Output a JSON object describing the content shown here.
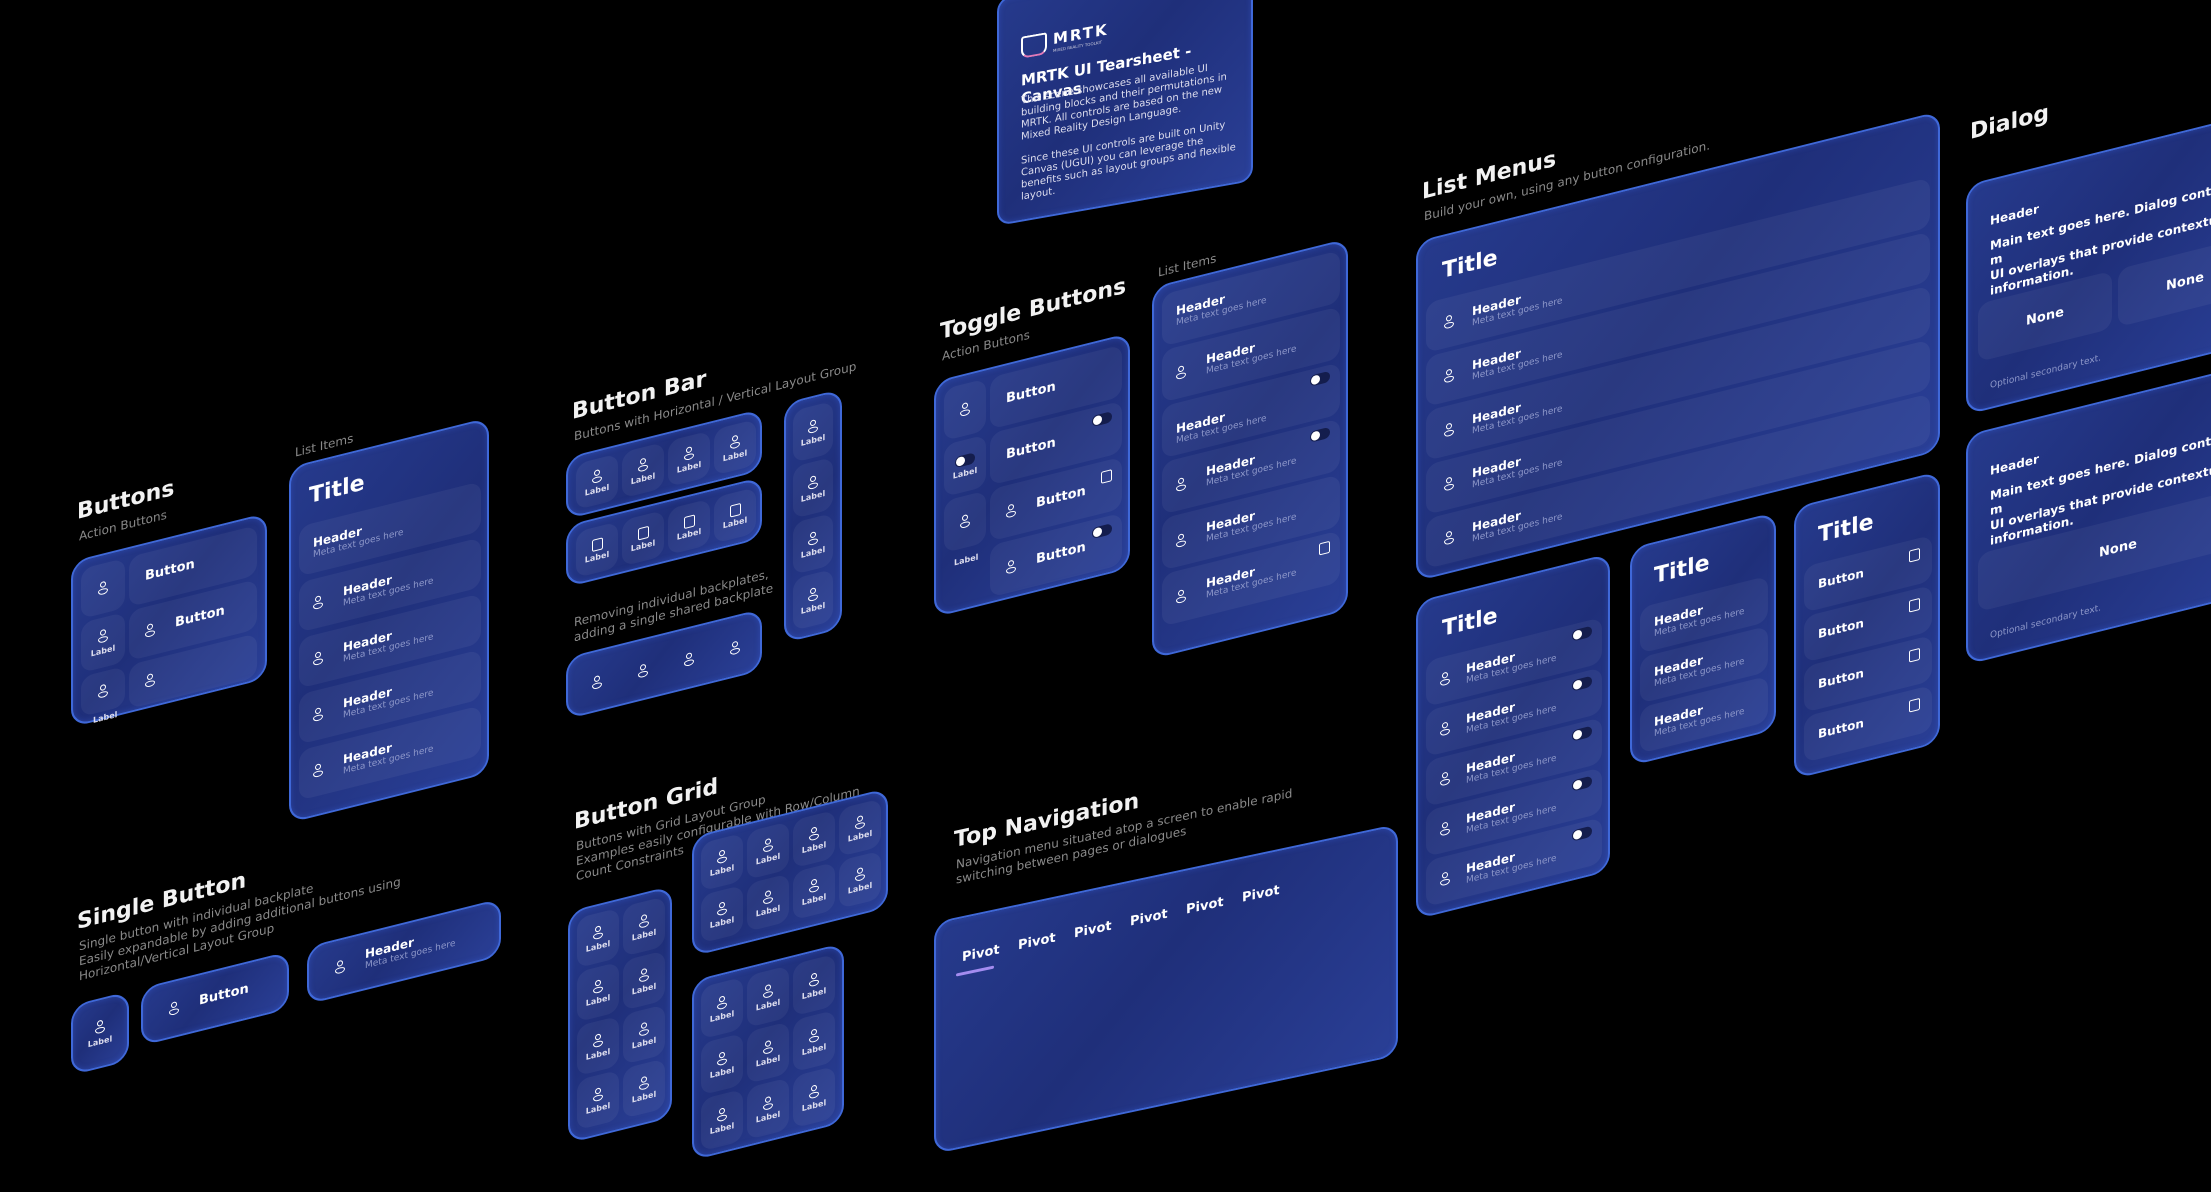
{
  "intro": {
    "logo_text": "MRTK",
    "logo_subtext": "MIXED REALITY TOOLKIT",
    "title": "MRTK UI Tearsheet - Canvas",
    "para1": "This scene showcases all available UI building blocks and their permutations in MRTK. All controls are based on the new Mixed Reality Design Language.",
    "para2": "Since these UI controls are built on Unity Canvas (UGUI) you can leverage the benefits such as layout groups and flexible layout."
  },
  "buttons": {
    "title": "Buttons",
    "subtitle": "Action Buttons",
    "button_label": "Button",
    "icon_label": "Label",
    "list_caption": "List Items",
    "list_title": "Title",
    "header": "Header",
    "meta": "Meta text goes here"
  },
  "single_button": {
    "title": "Single Button",
    "desc1": "Single button with individual backplate",
    "desc2": "Easily expandable by adding additional buttons using",
    "desc3": "Horizontal/Vertical Layout Group",
    "icon_label": "Label",
    "button_label": "Button",
    "header": "Header",
    "meta": "Meta text goes here"
  },
  "button_bar": {
    "title": "Button Bar",
    "subtitle": "Buttons with Horizontal / Vertical Layout Group",
    "shared_desc1": "Removing individual backplates,",
    "shared_desc2": "adding a single shared backplate",
    "icon_label": "Label"
  },
  "button_grid": {
    "title": "Button Grid",
    "desc1": "Buttons with Grid Layout Group",
    "desc2": "Examples easily configurable with Row/Column",
    "desc3": "Count Constraints",
    "icon_label": "Label"
  },
  "toggle_buttons": {
    "title": "Toggle Buttons",
    "subtitle": "Action Buttons",
    "button_label": "Button",
    "icon_label": "Label",
    "list_caption": "List Items",
    "header": "Header",
    "meta": "Meta text goes here"
  },
  "top_navigation": {
    "title": "Top Navigation",
    "desc1": "Navigation menu situated atop a screen to enable rapid",
    "desc2": "switching between pages or dialogues",
    "pivots": [
      "Pivot",
      "Pivot",
      "Pivot",
      "Pivot",
      "Pivot",
      "Pivot"
    ],
    "active_index": 0
  },
  "list_menus": {
    "title": "List Menus",
    "subtitle": "Build your own, using any button configuration.",
    "panel_title": "Title",
    "header": "Header",
    "meta": "Meta text goes here",
    "button_label": "Button"
  },
  "dialog": {
    "title": "Dialog",
    "header": "Header",
    "main_text": "Main text goes here. Dialog controls are modal UI overlays that provide contextual app information.",
    "main_line1": "Main text goes here. Dialog controls are m",
    "main_line2": "UI overlays that provide contextual app",
    "main_line3": "information.",
    "option_none": "None",
    "secondary": "Optional secondary text."
  },
  "colors": {
    "background": "#000000",
    "panel": "#23348a",
    "panel_border": "#3f68d8",
    "pivot_accent": "#a48cf0",
    "meta_text": "#8d97c9"
  }
}
